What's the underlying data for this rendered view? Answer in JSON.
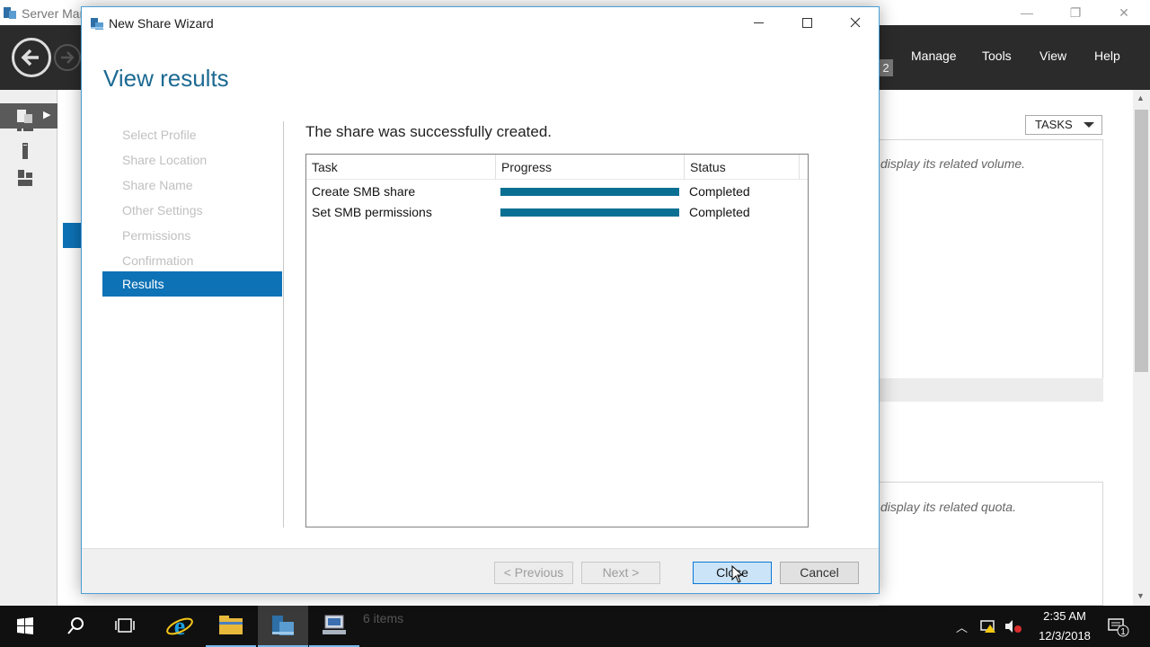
{
  "background_app": {
    "title": "Server Mar",
    "menu": [
      "Manage",
      "Tools",
      "View",
      "Help"
    ],
    "notification_badge": "2",
    "tasks_label": "TASKS",
    "hint_volume": "display its related volume.",
    "hint_quota": "display its related quota.",
    "status_items": "6 items"
  },
  "wizard": {
    "window_title": "New Share Wizard",
    "heading": "View results",
    "steps": [
      {
        "label": "Select Profile",
        "state": "disabled"
      },
      {
        "label": "Share Location",
        "state": "disabled"
      },
      {
        "label": "Share Name",
        "state": "disabled"
      },
      {
        "label": "Other Settings",
        "state": "disabled"
      },
      {
        "label": "Permissions",
        "state": "disabled"
      },
      {
        "label": "Confirmation",
        "state": "disabled"
      },
      {
        "label": "Results",
        "state": "active"
      }
    ],
    "message": "The share was successfully created.",
    "table": {
      "columns": [
        "Task",
        "Progress",
        "Status"
      ],
      "rows": [
        {
          "task": "Create SMB share",
          "progress": 1.0,
          "status": "Completed"
        },
        {
          "task": "Set SMB permissions",
          "progress": 1.0,
          "status": "Completed"
        }
      ]
    },
    "buttons": {
      "previous": "< Previous",
      "next": "Next >",
      "close": "Close",
      "cancel": "Cancel"
    }
  },
  "taskbar": {
    "time": "2:35 AM",
    "date": "12/3/2018",
    "notification_count": "1"
  },
  "colors": {
    "accent": "#0d72b6",
    "heading": "#1c6a92",
    "progress_fill": "#0a7093"
  }
}
